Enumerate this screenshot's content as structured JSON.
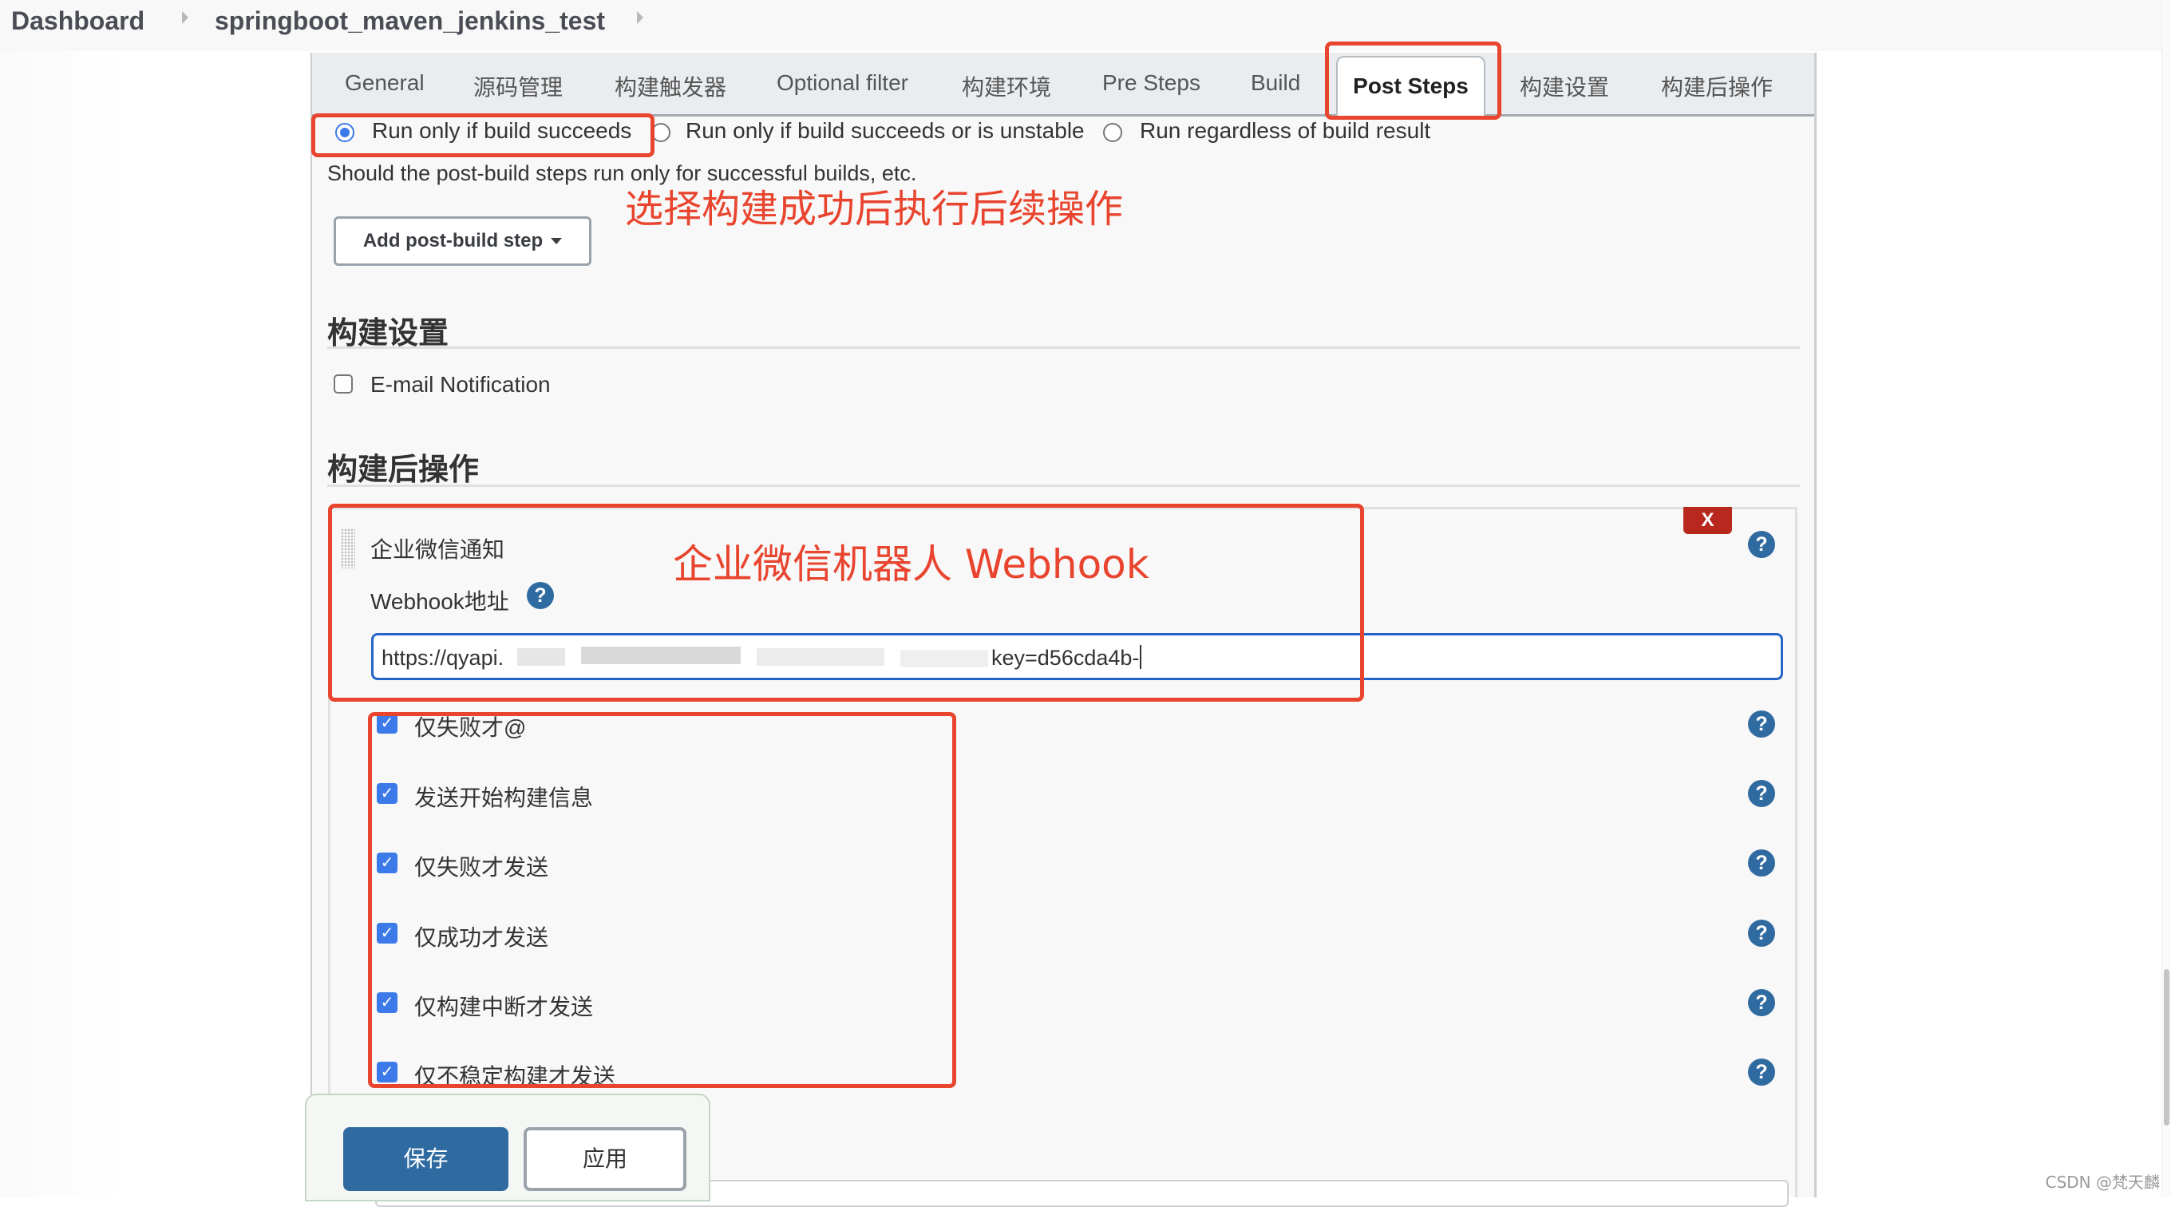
{
  "breadcrumb": {
    "items": [
      "Dashboard",
      "springboot_maven_jenkins_test"
    ]
  },
  "tabs": [
    {
      "label": "General",
      "active": false
    },
    {
      "label": "源码管理",
      "active": false
    },
    {
      "label": "构建触发器",
      "active": false
    },
    {
      "label": "Optional filter",
      "active": false
    },
    {
      "label": "构建环境",
      "active": false
    },
    {
      "label": "Pre Steps",
      "active": false
    },
    {
      "label": "Build",
      "active": false
    },
    {
      "label": "Post Steps",
      "active": true
    },
    {
      "label": "构建设置",
      "active": false
    },
    {
      "label": "构建后操作",
      "active": false
    }
  ],
  "post_steps": {
    "radios": [
      {
        "label": "Run only if build succeeds",
        "selected": true
      },
      {
        "label": "Run only if build succeeds or is unstable",
        "selected": false
      },
      {
        "label": "Run regardless of build result",
        "selected": false
      }
    ],
    "description": "Should the post-build steps run only for successful builds, etc.",
    "add_button_label": "Add post-build step"
  },
  "build_settings": {
    "heading": "构建设置",
    "email_notification": {
      "label": "E-mail Notification",
      "checked": false
    }
  },
  "post_build": {
    "heading": "构建后操作",
    "delete_label": "X",
    "help_glyph": "?",
    "wechat": {
      "title": "企业微信通知",
      "webhook_label": "Webhook地址",
      "webhook_value_prefix": "https://qyapi.",
      "webhook_value_suffix": "key=d56cda4b-",
      "options": [
        {
          "label": "仅失败才@",
          "checked": true
        },
        {
          "label": "发送开始构建信息",
          "checked": true
        },
        {
          "label": "仅失败才发送",
          "checked": true
        },
        {
          "label": "仅成功才发送",
          "checked": true
        },
        {
          "label": "仅构建中断才发送",
          "checked": true
        },
        {
          "label": "仅不稳定构建才发送",
          "checked": true
        }
      ]
    }
  },
  "annotations": {
    "post_steps_note": "选择构建成功后执行后续操作",
    "webhook_note": "企业微信机器人 Webhook"
  },
  "footer": {
    "save_label": "保存",
    "apply_label": "应用"
  },
  "watermark": "CSDN @梵天麟",
  "colors": {
    "annotation_red": "#e8442e",
    "primary_blue": "#2f6aa1",
    "checkbox_blue": "#3b7ae8",
    "delete_red": "#b9281e"
  }
}
